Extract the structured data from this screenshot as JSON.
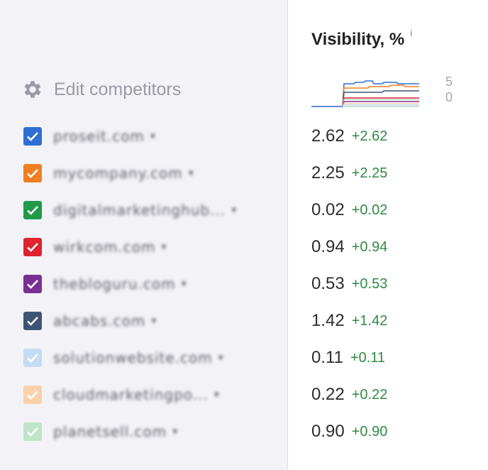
{
  "left": {
    "edit_label": "Edit competitors"
  },
  "right": {
    "header": "Visibility, %",
    "info": "i",
    "axis_top": "5",
    "axis_bottom": "0"
  },
  "competitors": [
    {
      "domain": "proseit.com",
      "color": "#2f6fd4",
      "value": "2.62",
      "delta": "+2.62",
      "checked": true
    },
    {
      "domain": "mycompany.com",
      "color": "#f07f22",
      "value": "2.25",
      "delta": "+2.25",
      "checked": true
    },
    {
      "domain": "digitalmarketinghub...",
      "color": "#1f9a4b",
      "value": "0.02",
      "delta": "+0.02",
      "checked": true
    },
    {
      "domain": "wirkcom.com",
      "color": "#e0232f",
      "value": "0.94",
      "delta": "+0.94",
      "checked": true
    },
    {
      "domain": "thebloguru.com",
      "color": "#7b2f93",
      "value": "0.53",
      "delta": "+0.53",
      "checked": true
    },
    {
      "domain": "abcabs.com",
      "color": "#3d5573",
      "value": "1.42",
      "delta": "+1.42",
      "checked": true
    },
    {
      "domain": "solutionwebsite.com",
      "color": "#c6dcf4",
      "value": "0.11",
      "delta": "+0.11",
      "checked": true
    },
    {
      "domain": "cloudmarketingpo...",
      "color": "#f9d2ab",
      "value": "0.22",
      "delta": "+0.22",
      "checked": true
    },
    {
      "domain": "planetsell.com",
      "color": "#bfe4c8",
      "value": "0.90",
      "delta": "+0.90",
      "checked": true
    }
  ]
}
